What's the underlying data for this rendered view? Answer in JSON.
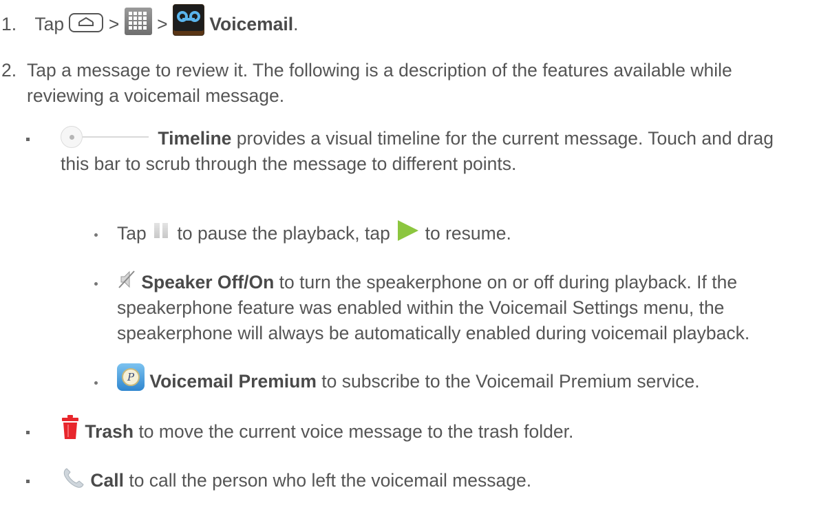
{
  "step1": {
    "number": "1.",
    "tap": "Tap",
    "sep1": ">",
    "sep2": ">",
    "voicemail": "Voicemail",
    "end": "."
  },
  "step2": {
    "number": "2.",
    "text": "Tap a message to review it. The following is a description of the features available while reviewing a voicemail message."
  },
  "timeline": {
    "label": "Timeline",
    "text": " provides a visual timeline for the current message. Touch and drag this bar to scrub through the message to different points."
  },
  "pause": {
    "tap": "Tap",
    "mid": "to pause the playback, tap",
    "end": "to resume."
  },
  "speaker": {
    "label": "Speaker Off/On",
    "text": " to turn the speakerphone on or off during playback. If the speakerphone feature was enabled within the Voicemail Settings menu, the speakerphone will always be automatically enabled during voicemail playback."
  },
  "premium": {
    "label": "Voicemail Premium",
    "text": " to subscribe to the Voicemail Premium service."
  },
  "trash": {
    "label": "Trash",
    "text": " to move the current voice message to the trash folder."
  },
  "call": {
    "label": "Call",
    "text": " to call the person who left the voicemail message."
  },
  "icons": {
    "home": "home-icon",
    "apps": "apps-grid-icon",
    "voicemail": "voicemail-icon",
    "timeline": "timeline-slider-icon",
    "pause": "pause-icon",
    "play": "play-icon",
    "speaker": "speaker-off-icon",
    "premium": "voicemail-premium-icon",
    "trash": "trash-icon",
    "call": "phone-icon"
  },
  "colors": {
    "text": "#555555",
    "play": "#8cc63f",
    "trash": "#e8262c"
  }
}
